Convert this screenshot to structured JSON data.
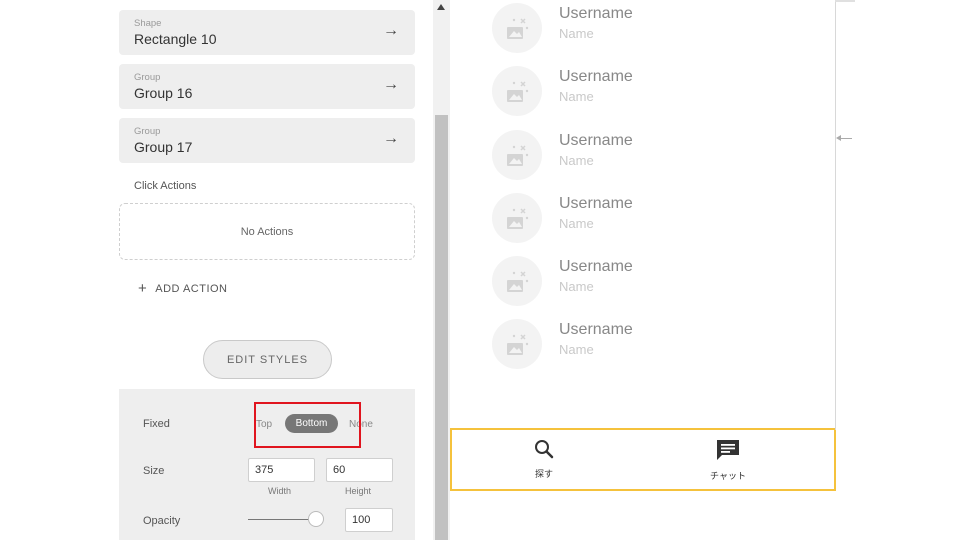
{
  "layers": [
    {
      "kind": "Shape",
      "name": "Rectangle 10"
    },
    {
      "kind": "Group",
      "name": "Group 16"
    },
    {
      "kind": "Group",
      "name": "Group 17"
    }
  ],
  "click_actions": {
    "label": "Click Actions",
    "empty_text": "No Actions",
    "add_label": "ADD ACTION"
  },
  "edit_styles_label": "EDIT STYLES",
  "styles": {
    "fixed_label": "Fixed",
    "fixed_options": [
      "Top",
      "Bottom",
      "None"
    ],
    "fixed_selected": "Bottom",
    "size_label": "Size",
    "width_value": "375",
    "height_value": "60",
    "width_label": "Width",
    "height_label": "Height",
    "opacity_label": "Opacity",
    "opacity_value": "100"
  },
  "users": [
    {
      "username": "Username",
      "name": "Name"
    },
    {
      "username": "Username",
      "name": "Name"
    },
    {
      "username": "Username",
      "name": "Name"
    },
    {
      "username": "Username",
      "name": "Name"
    },
    {
      "username": "Username",
      "name": "Name"
    },
    {
      "username": "Username",
      "name": "Name"
    }
  ],
  "tabbar": {
    "tabs": [
      {
        "label": "探す",
        "icon": "search-icon"
      },
      {
        "label": "チャット",
        "icon": "chat-icon"
      }
    ],
    "border_color": "#f5c23c"
  },
  "icons": {
    "layer_arrow": "arrow-right-icon",
    "avatar": "broken-image-icon"
  },
  "colors": {
    "highlight": "#e0141e",
    "selected_segment": "#777777"
  }
}
